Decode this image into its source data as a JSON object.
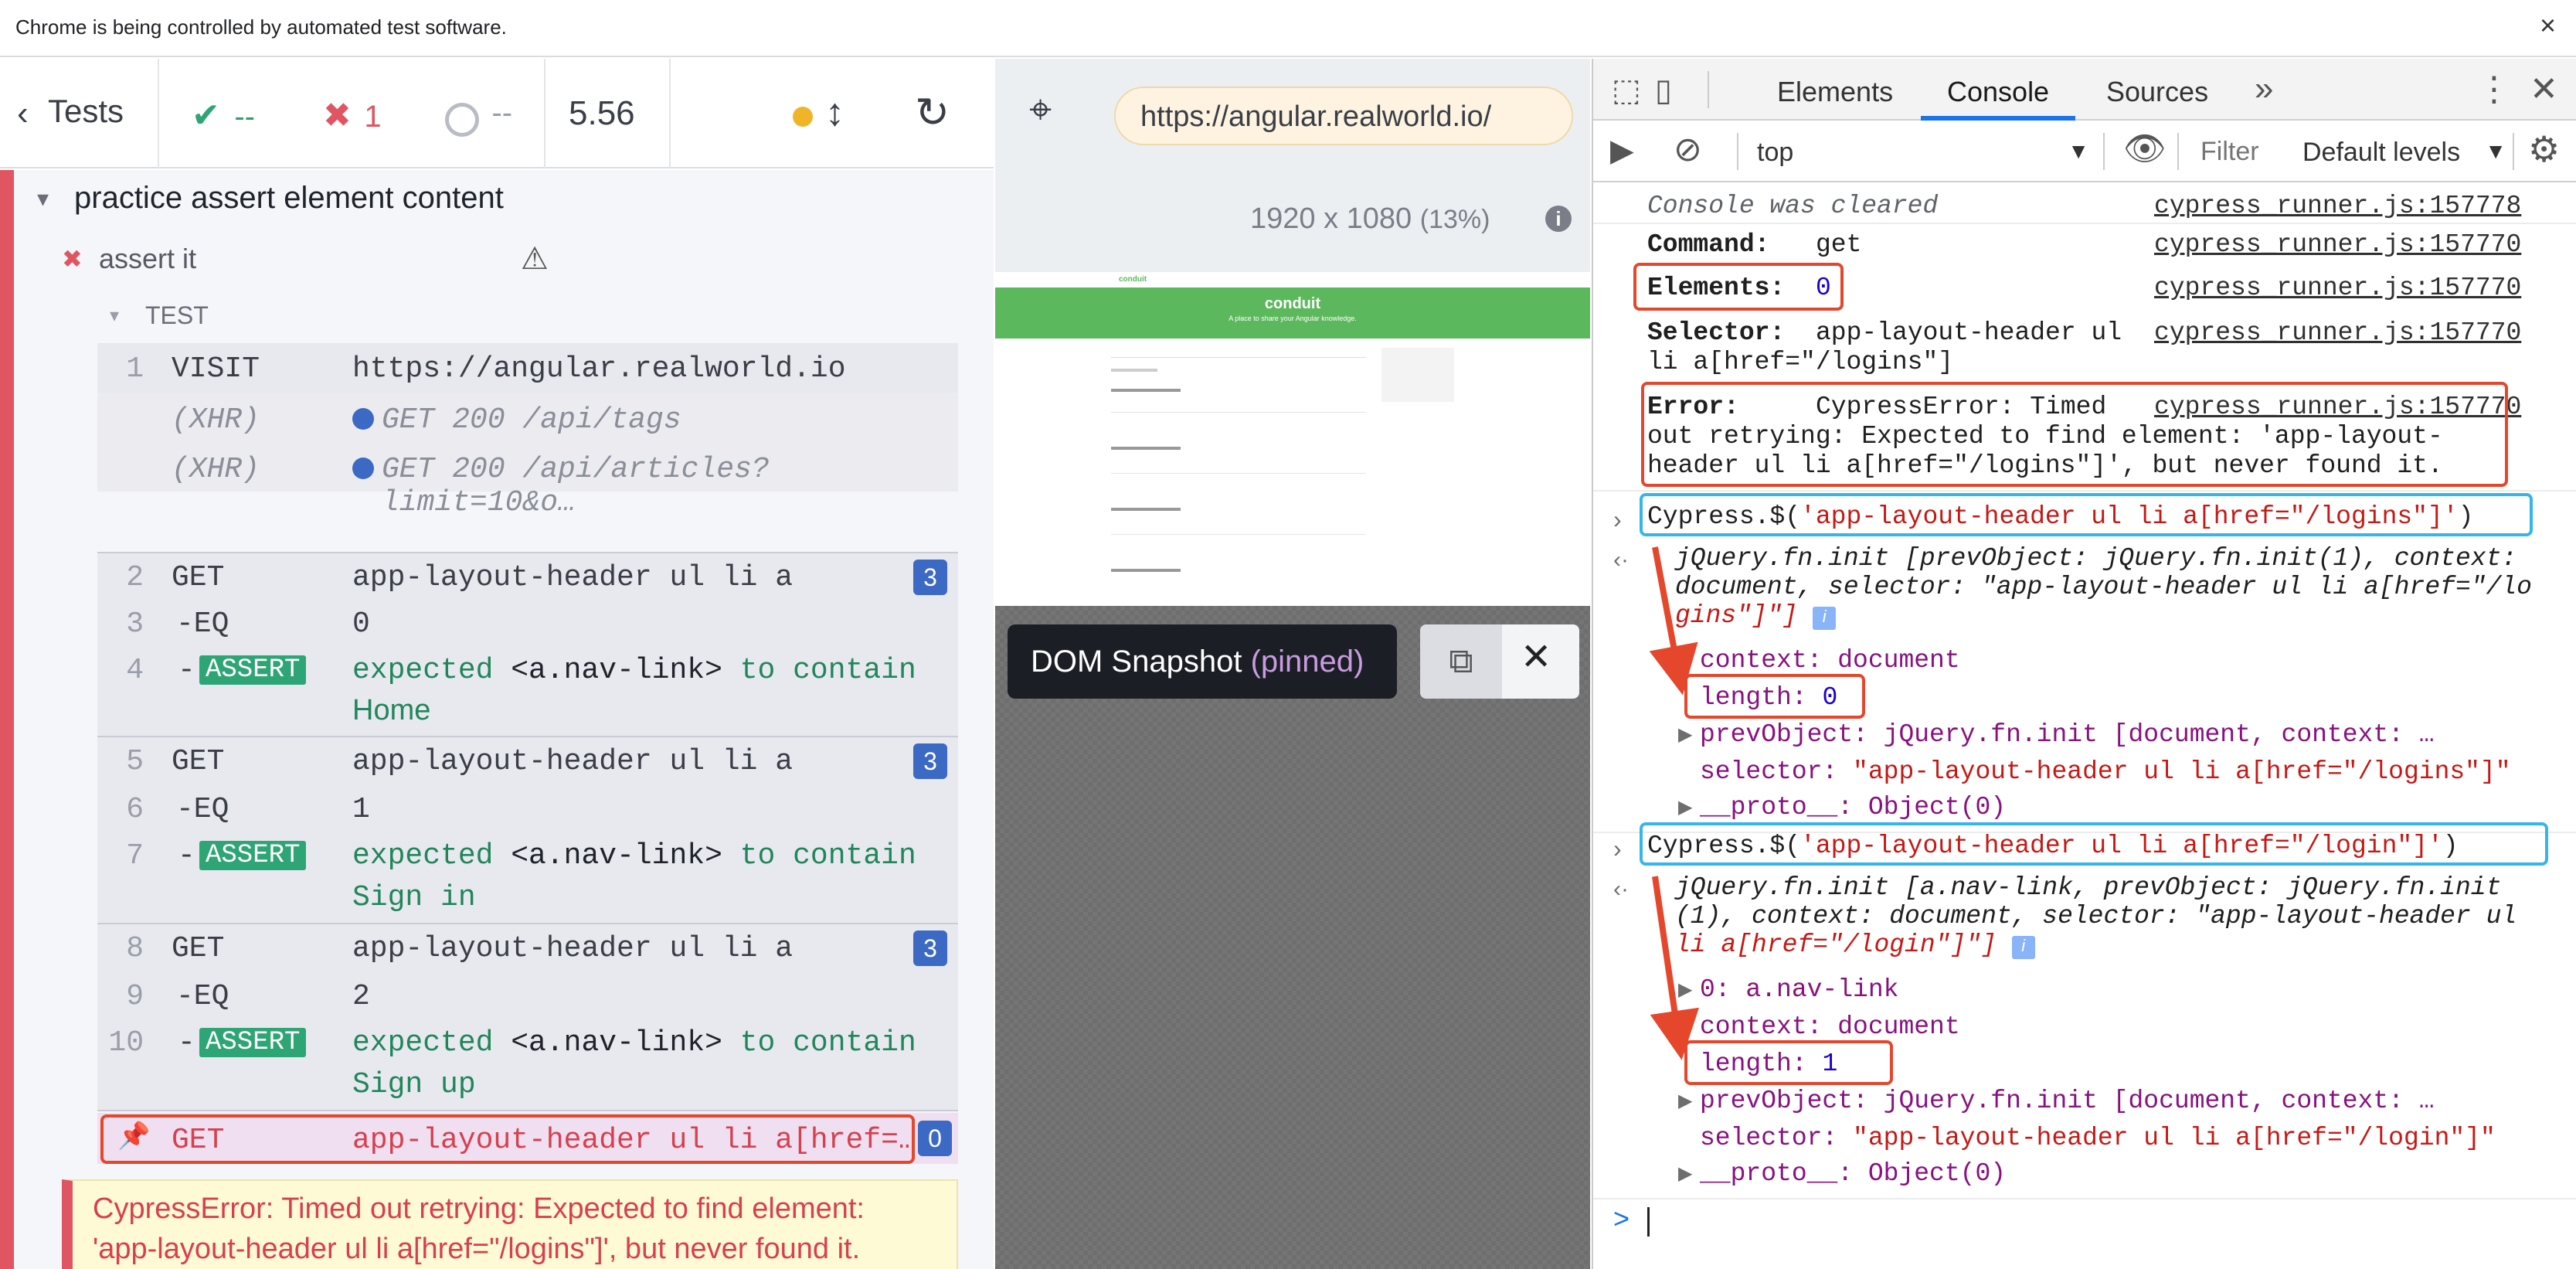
{
  "banner": {
    "text": "Chrome is being controlled by automated test software.",
    "close": "×"
  },
  "runner": {
    "back_label": "Tests",
    "passed": "--",
    "failed": "1",
    "pending": "--",
    "duration": "5.56",
    "suite_title": "practice assert element content",
    "test_title": "assert it",
    "section_label": "TEST",
    "commands": [
      {
        "num": "1",
        "cmd": "VISIT",
        "msg": "https://angular.realworld.io"
      },
      {
        "num": "",
        "cmd": "(XHR)",
        "msg": "GET 200 /api/tags"
      },
      {
        "num": "",
        "cmd": "(XHR)",
        "msg": "GET 200 /api/articles?limit=10&o…"
      },
      {
        "num": "2",
        "cmd": "GET",
        "msg": "app-layout-header ul li a",
        "badge": "3"
      },
      {
        "num": "3",
        "cmd": "-EQ",
        "msg": "0"
      },
      {
        "num": "4",
        "cmd": "ASSERT",
        "msg_prefix": "expected",
        "msg_el": "<a.nav-link>",
        "msg_mid": "to contain",
        "msg_val": "Home"
      },
      {
        "num": "5",
        "cmd": "GET",
        "msg": "app-layout-header ul li a",
        "badge": "3"
      },
      {
        "num": "6",
        "cmd": "-EQ",
        "msg": "1"
      },
      {
        "num": "7",
        "cmd": "ASSERT",
        "msg_prefix": "expected",
        "msg_el": "<a.nav-link>",
        "msg_mid": "to contain",
        "msg_val": "Sign in"
      },
      {
        "num": "8",
        "cmd": "GET",
        "msg": "app-layout-header ul li a",
        "badge": "3"
      },
      {
        "num": "9",
        "cmd": "-EQ",
        "msg": "2"
      },
      {
        "num": "10",
        "cmd": "ASSERT",
        "msg_prefix": "expected",
        "msg_el": "<a.nav-link>",
        "msg_mid": "to contain",
        "msg_val": "Sign up"
      },
      {
        "num": "",
        "cmd": "GET",
        "msg": "app-layout-header ul li a[href=…",
        "badge": "0"
      }
    ],
    "error_text": "CypressError: Timed out retrying: Expected to find element: 'app-layout-header ul li a[href=\"/logins\"]', but never found it."
  },
  "preview": {
    "url": "https://angular.realworld.io/",
    "viewport": "1920 x 1080",
    "scale": "(13%)",
    "app_brand": "conduit",
    "app_hero_title": "conduit",
    "app_hero_sub": "A place to share your Angular knowledge.",
    "snapshot_label": "DOM Snapshot",
    "snapshot_pinned": "(pinned)"
  },
  "devtools": {
    "tabs": [
      "Elements",
      "Console",
      "Sources"
    ],
    "active_tab": "Console",
    "context": "top",
    "filter_placeholder": "Filter",
    "levels": "Default levels",
    "cleared": "Console was cleared",
    "src1": "cypress_runner.js:157778",
    "src2": "cypress_runner.js:157770",
    "command_key": "Command:",
    "command_val": "get",
    "elements_key": "Elements:",
    "elements_val": "0",
    "selector_key": "Selector:",
    "selector_line1": "app-layout-header ul",
    "selector_line2": "li a[href=\"/logins\"]",
    "error_key": "Error:",
    "error_line1": "CypressError: Timed",
    "error_line2": "out retrying: Expected to find element: 'app-layout-",
    "error_line3": "header ul li a[href=\"/logins\"]', but never found it.",
    "cmd1_prefix": "Cypress.$(",
    "cmd1_str": "'app-layout-header ul li a[href=\"/logins\"]'",
    "cmd1_suffix": ")",
    "res1_line1a": "jQuery.fn.init [prevObject: jQuery.fn.init(1), context:",
    "res1_line2": "document, selector: \"app-layout-header ul li a[href=\"/lo",
    "res1_line3": "gins\"]\"]",
    "res1_context": "context: document",
    "res1_length_key": "length:",
    "res1_length_val": "0",
    "res1_prev": "prevObject: jQuery.fn.init [document, context: …",
    "res1_selector_key": "selector:",
    "res1_selector_val": "\"app-layout-header ul li a[href=\"/logins\"]\"",
    "res1_proto": "__proto__: Object(0)",
    "cmd2_prefix": "Cypress.$(",
    "cmd2_str": "'app-layout-header ul li a[href=\"/login\"]'",
    "cmd2_suffix": ")",
    "res2_line1": "jQuery.fn.init [a.nav-link, prevObject: jQuery.fn.init",
    "res2_line2": "(1), context: document, selector: \"app-layout-header ul",
    "res2_line3": "li a[href=\"/login\"]\"]",
    "res2_zero": "0: a.nav-link",
    "res2_context": "context: document",
    "res2_length_key": "length:",
    "res2_length_val": "1",
    "res2_prev": "prevObject: jQuery.fn.init [document, context: …",
    "res2_selector_key": "selector:",
    "res2_selector_val": "\"app-layout-header ul li a[href=\"/login\"]\"",
    "res2_proto": "__proto__: Object(0)",
    "prompt": ">"
  },
  "colors": {
    "fail": "#e05562",
    "pass": "#2ea575",
    "badge": "#3b69c4",
    "annotation_red": "#e4472c",
    "annotation_blue": "#35b6ea"
  }
}
